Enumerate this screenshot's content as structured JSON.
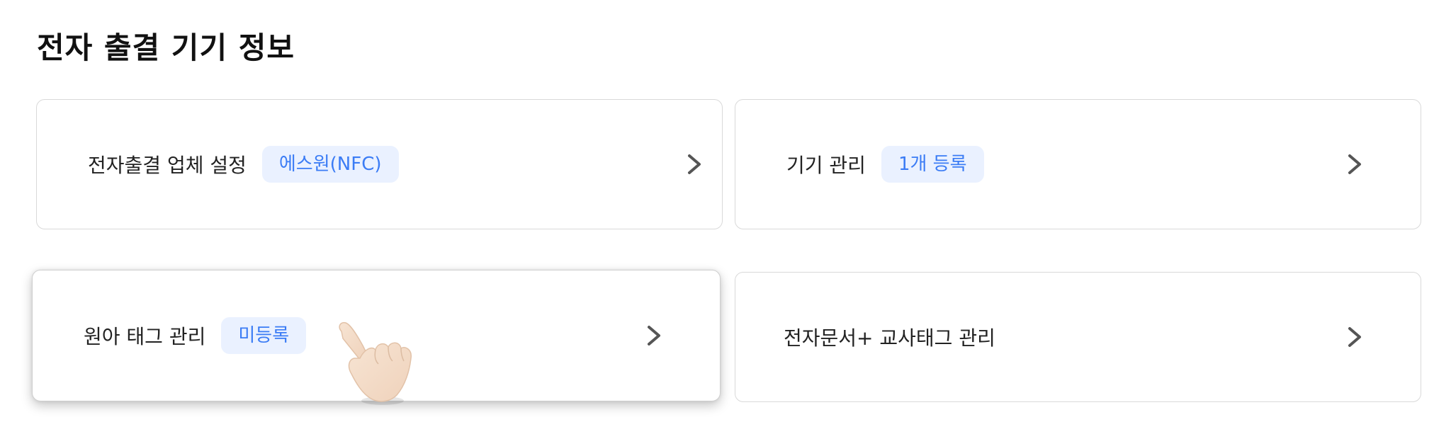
{
  "section": {
    "title": "전자 출결 기기 정보"
  },
  "cards": [
    {
      "label": "전자출결 업체 설정",
      "badge": "에스원(NFC)"
    },
    {
      "label": "기기 관리",
      "badge": "1개 등록"
    },
    {
      "label": "원아 태그 관리",
      "badge": "미등록"
    },
    {
      "label": "전자문서+ 교사태그 관리"
    }
  ],
  "colors": {
    "badge_bg": "#eaf1ff",
    "badge_text": "#3b7cf5",
    "border": "#d9d9d9",
    "chevron": "#555555"
  },
  "icons": {
    "chevron": "chevron-right-icon",
    "pointer": "hand-pointer-icon"
  }
}
